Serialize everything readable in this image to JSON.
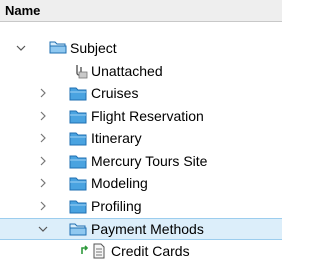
{
  "header": {
    "label": "Name"
  },
  "tree": {
    "root": {
      "label": "Subject",
      "icon": "folder-open-icon",
      "expanded": true
    },
    "items": [
      {
        "label": "Unattached",
        "icon": "unattached-icon"
      },
      {
        "label": "Cruises",
        "icon": "folder-icon",
        "expanded": false
      },
      {
        "label": "Flight Reservation",
        "icon": "folder-icon",
        "expanded": false
      },
      {
        "label": "Itinerary",
        "icon": "folder-icon",
        "expanded": false
      },
      {
        "label": "Mercury Tours Site",
        "icon": "folder-icon",
        "expanded": false
      },
      {
        "label": "Modeling",
        "icon": "folder-icon",
        "expanded": false
      },
      {
        "label": "Profiling",
        "icon": "folder-icon",
        "expanded": false
      },
      {
        "label": "Payment Methods",
        "icon": "folder-open-icon",
        "expanded": true,
        "selected": true
      }
    ],
    "children": [
      {
        "label": "Credit Cards",
        "icon": "test-document-icon"
      }
    ]
  },
  "colors": {
    "folder_fill": "#4aa3e0",
    "folder_edge": "#1f6fb2",
    "selection_bg": "#dceefa",
    "selection_border": "#9ccdee",
    "header_bg": "#eeeeee"
  }
}
